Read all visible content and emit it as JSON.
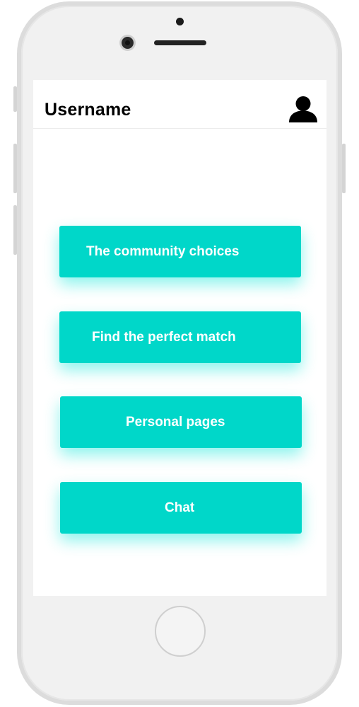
{
  "header": {
    "title": "Username",
    "avatar_icon": "user-profile-icon"
  },
  "menu": {
    "items": [
      {
        "label": "The community choices"
      },
      {
        "label": "Find the perfect match"
      },
      {
        "label": "Personal pages"
      },
      {
        "label": "Chat"
      }
    ]
  },
  "colors": {
    "accent": "#00d7c9",
    "button_text": "#ffffff",
    "title_text": "#000000",
    "device_frame": "#f1f1f1"
  }
}
